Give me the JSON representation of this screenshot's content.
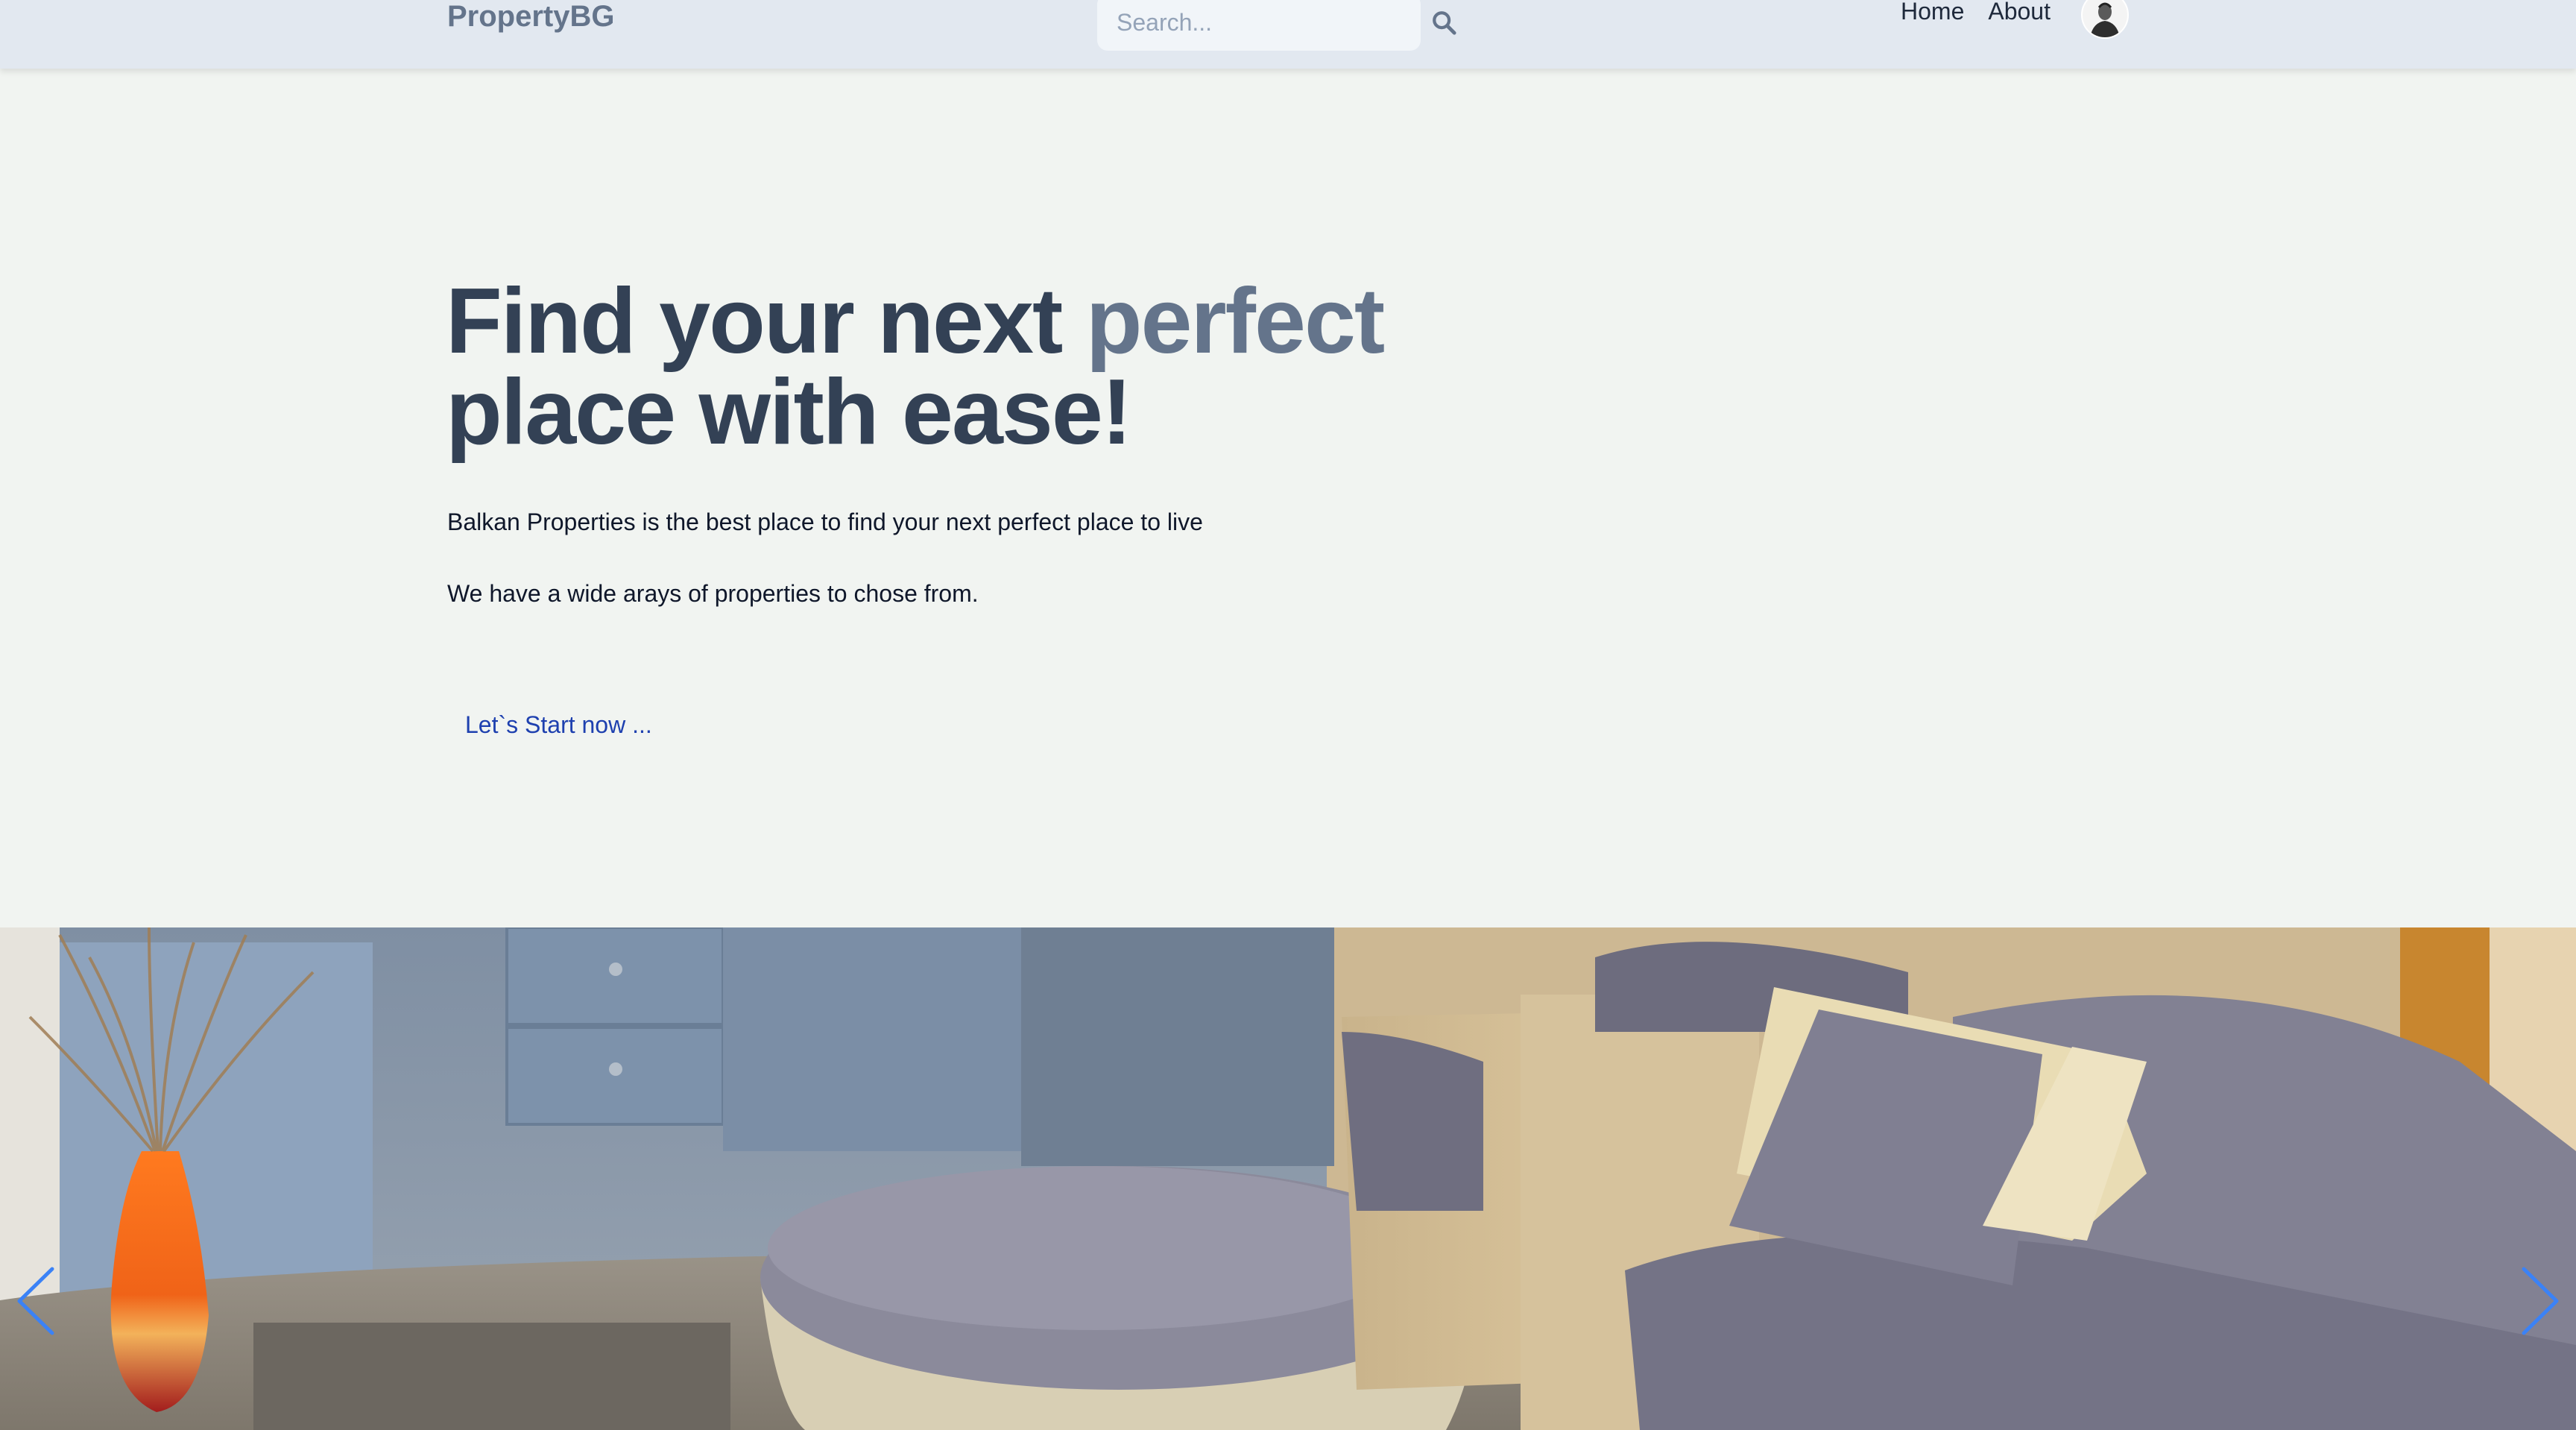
{
  "header": {
    "brand": "PropertyBG",
    "search_placeholder": "Search...",
    "search_icon": "search-icon",
    "nav": [
      {
        "label": "Home"
      },
      {
        "label": "About"
      }
    ],
    "avatar_icon": "user-avatar"
  },
  "hero": {
    "title_part1": "Find your next ",
    "title_accent": "perfect",
    "title_part2": "place with ease!",
    "paragraph1": "Balkan Properties is the best place to find your next perfect place to live",
    "paragraph2": "We have a wide arays of properties to chose from.",
    "cta_label": "Let`s Start now ..."
  },
  "carousel": {
    "prev_icon": "chevron-left-icon",
    "next_icon": "chevron-right-icon",
    "arrow_color": "#3b82f6"
  },
  "colors": {
    "header_bg": "#e2e8f0",
    "page_bg": "#f1f4f1",
    "title": "#334155",
    "title_accent": "#64748b",
    "link": "#1e40af"
  }
}
